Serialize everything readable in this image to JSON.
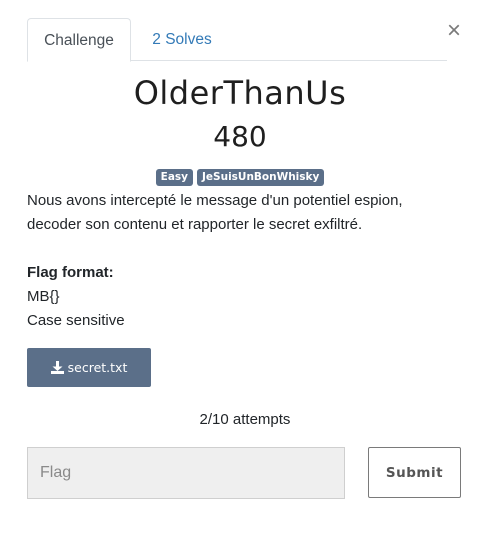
{
  "close_glyph": "×",
  "tabs": [
    {
      "label": "Challenge"
    },
    {
      "label": "2 Solves"
    }
  ],
  "challenge": {
    "name": "OlderThanUs",
    "value": "480",
    "tags": [
      "Easy",
      "JeSuisUnBonWhisky"
    ],
    "description": "Nous avons intercepté le message d'un potentiel espion, decoder son contenu et rapporter le secret exfiltré.",
    "flag_format_label": "Flag format:",
    "flag_format_lines": [
      "MB{}",
      "Case sensitive"
    ],
    "file": {
      "label": "secret.txt",
      "icon": "download-icon"
    },
    "attempts": "2/10 attempts"
  },
  "form": {
    "placeholder": "Flag",
    "submit_label": "Submit"
  },
  "colors": {
    "tag_bg": "#5b6f89",
    "link": "#337ab7",
    "file_button_bg": "#5b6f89"
  }
}
